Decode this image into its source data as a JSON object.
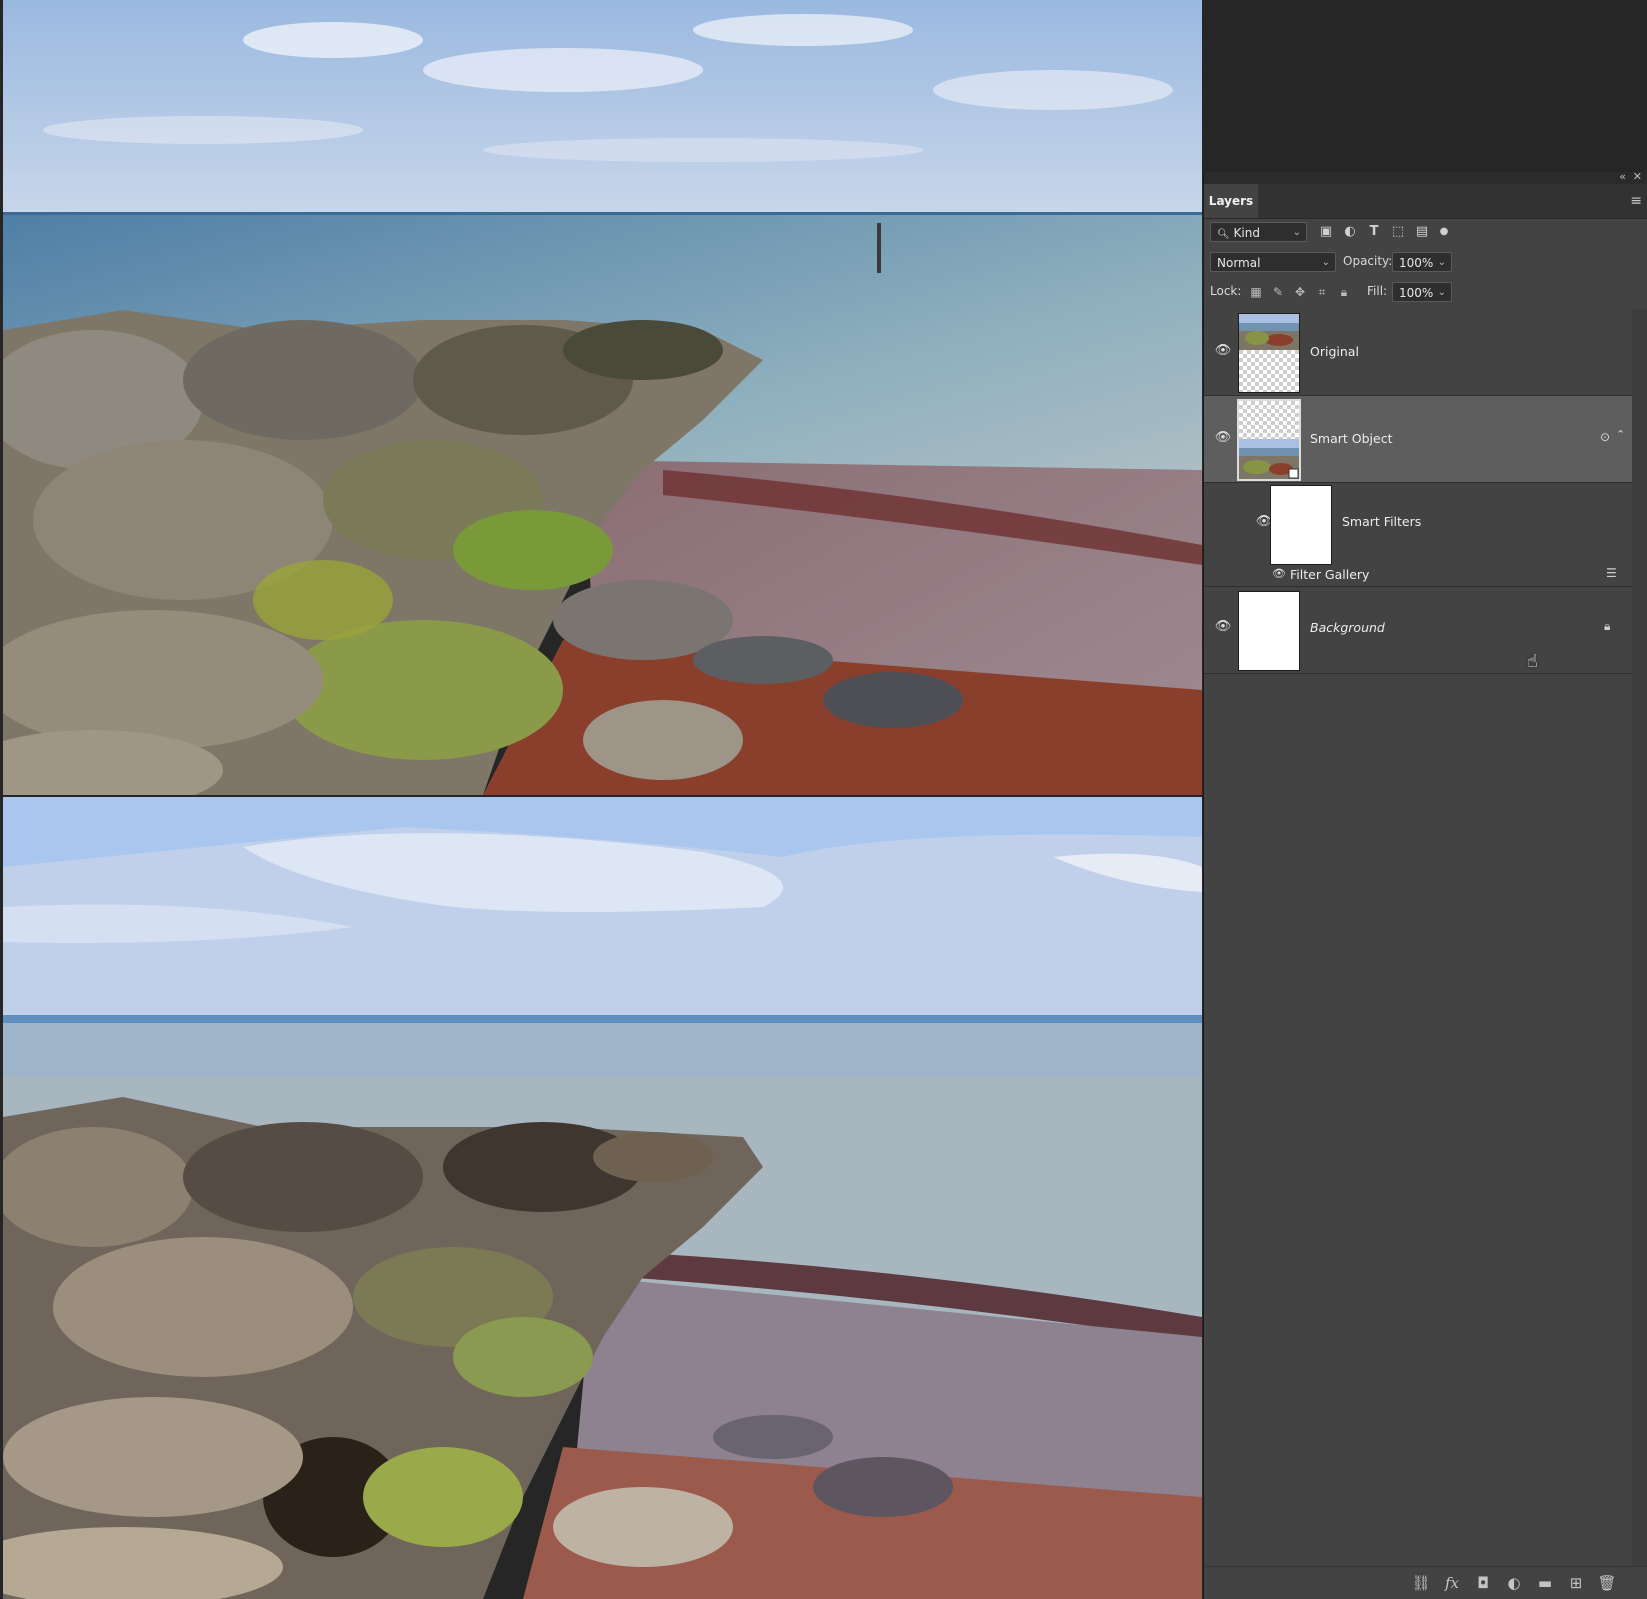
{
  "layers_panel": {
    "title": "Layers",
    "filter": {
      "kind_label": "Kind"
    },
    "blend_mode": "Normal",
    "opacity_label": "Opacity:",
    "opacity_value": "100%",
    "lock_label": "Lock:",
    "fill_label": "Fill:",
    "fill_value": "100%",
    "layers": [
      {
        "name": "Original",
        "visible": true
      },
      {
        "name": "Smart Object",
        "visible": true,
        "selected": true,
        "smart_filters_label": "Smart Filters",
        "filter_name": "Filter Gallery"
      },
      {
        "name": "Background",
        "visible": true,
        "locked": true
      }
    ]
  },
  "icons": {
    "panel_collapse": "collapse-icon",
    "panel_close": "close-icon",
    "panel_menu": "menu-icon",
    "filter_pixel": "image-icon",
    "filter_adjustment": "adjustment-icon",
    "filter_type": "type-icon",
    "filter_shape": "shape-icon",
    "filter_smart": "smart-object-icon",
    "filter_toggle": "toggle-icon",
    "bottom": [
      "link-icon",
      "fx-icon",
      "mask-icon",
      "adjustment-icon",
      "folder-icon",
      "new-layer-icon",
      "trash-icon"
    ]
  },
  "colors": {
    "panel_bg": "#434343",
    "selected_layer": "#5e5e5e",
    "app_bg": "#262626"
  }
}
